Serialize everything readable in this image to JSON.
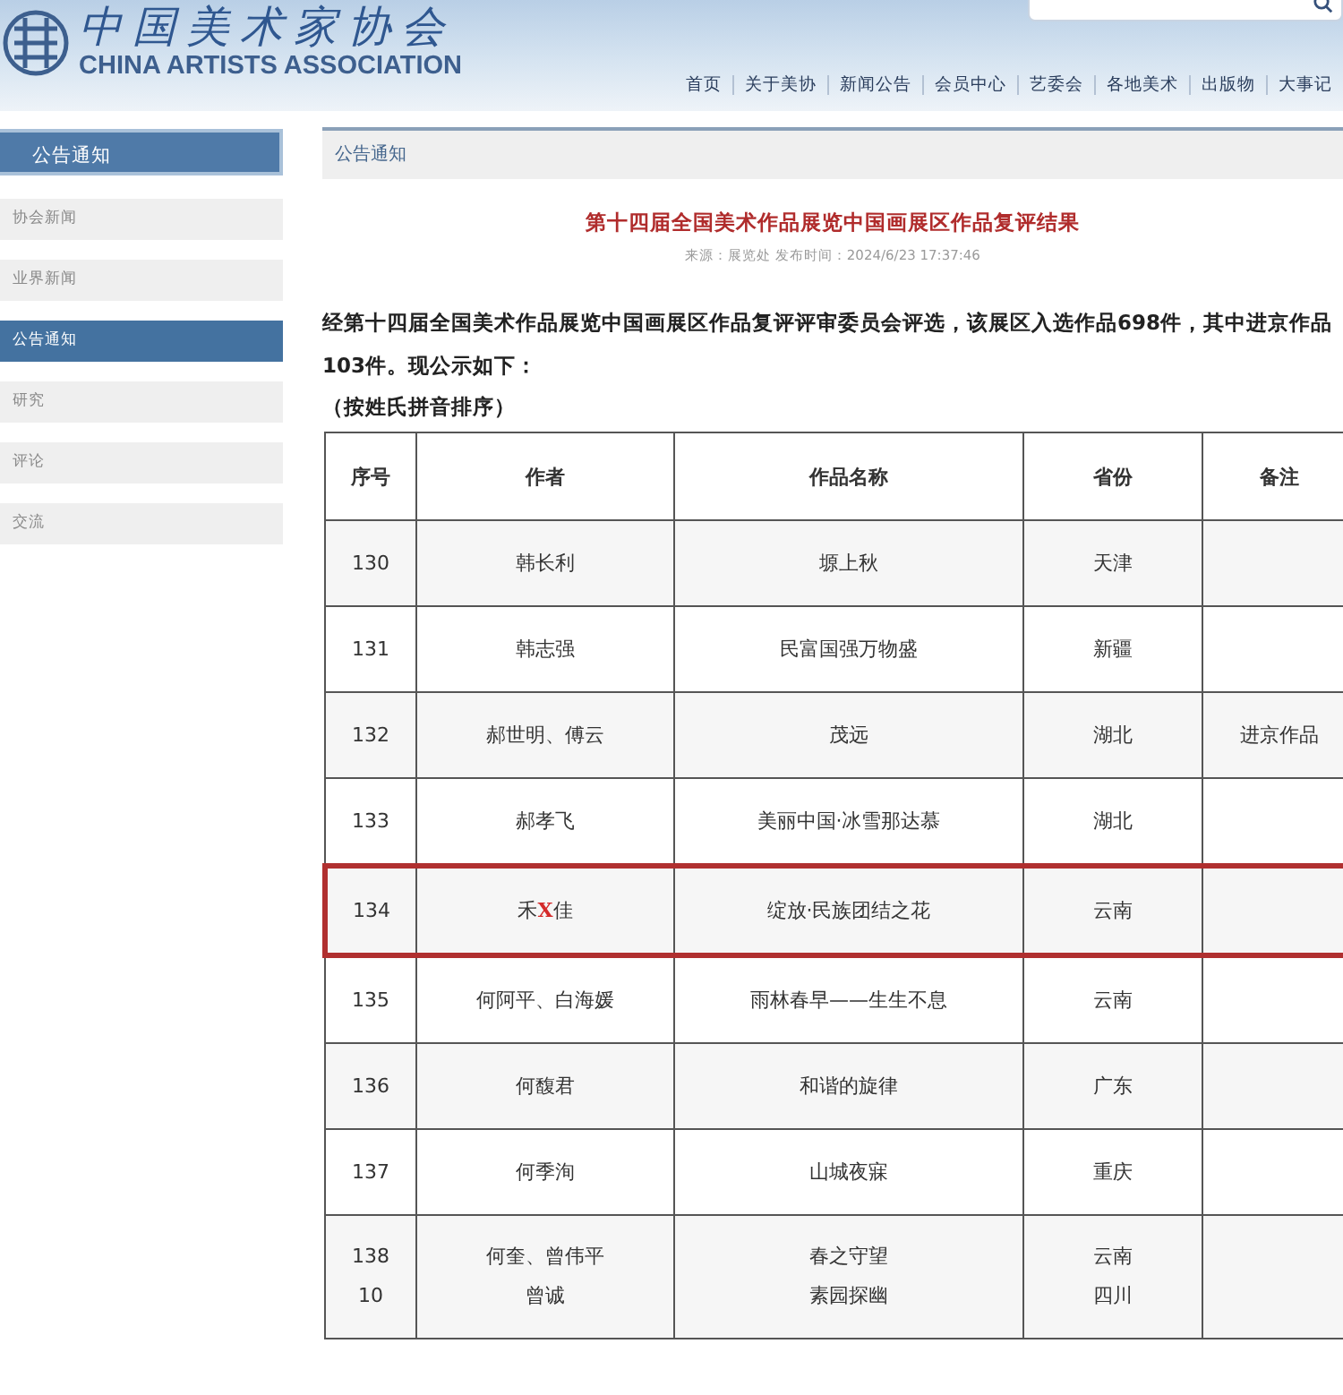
{
  "header": {
    "logo_cn": "中国美术家协会",
    "logo_en": "CHINA ARTISTS ASSOCIATION",
    "nav": [
      "首页",
      "关于美协",
      "新闻公告",
      "会员中心",
      "艺委会",
      "各地美术",
      "出版物",
      "大事记"
    ]
  },
  "sidebar": {
    "title": "公告通知",
    "items": [
      {
        "label": "协会新闻",
        "selected": false
      },
      {
        "label": "业界新闻",
        "selected": false
      },
      {
        "label": "公告通知",
        "selected": true
      },
      {
        "label": "研究",
        "selected": false
      },
      {
        "label": "评论",
        "selected": false
      },
      {
        "label": "交流",
        "selected": false
      }
    ]
  },
  "breadcrumb": "公告通知",
  "article": {
    "title": "第十四届全国美术作品展览中国画展区作品复评结果",
    "meta": "来源：展览处 发布时间：2024/6/23 17:37:46",
    "paragraph": "经第十四届全国美术作品展览中国画展区作品复评评审委员会评选，该展区入选作品698件，其中进京作品103件。现公示如下：",
    "note": "（按姓氏拼音排序）"
  },
  "table": {
    "columns": [
      "序号",
      "作者",
      "作品名称",
      "省份",
      "备注"
    ],
    "rows": [
      {
        "cells": [
          "130",
          "韩长利",
          "塬上秋",
          "天津",
          ""
        ],
        "highlighted": false
      },
      {
        "cells": [
          "131",
          "韩志强",
          "民富国强万物盛",
          "新疆",
          ""
        ],
        "highlighted": false
      },
      {
        "cells": [
          "132",
          "郝世明、傅云",
          "茂远",
          "湖北",
          "进京作品"
        ],
        "highlighted": false
      },
      {
        "cells": [
          "133",
          "郝孝飞",
          "美丽中国·冰雪那达慕",
          "湖北",
          ""
        ],
        "highlighted": false
      },
      {
        "cells": [
          "134",
          "禾**X**佳",
          "绽放·民族团结之花",
          "云南",
          ""
        ],
        "highlighted": true
      },
      {
        "cells": [
          "135",
          "何阿平、白海媛",
          "雨林春早——生生不息",
          "云南",
          ""
        ],
        "highlighted": false
      },
      {
        "cells": [
          "136",
          "何馥君",
          "和谐的旋律",
          "广东",
          ""
        ],
        "highlighted": false
      },
      {
        "cells": [
          "137",
          "何季洵",
          "山城夜寐",
          "重庆",
          ""
        ],
        "highlighted": false
      },
      {
        "cells": [
          [
            "138",
            "10"
          ],
          [
            "何奎、曾伟平",
            "曾诚"
          ],
          [
            "春之守望",
            "素园探幽"
          ],
          [
            "云南",
            "四川"
          ],
          ""
        ],
        "highlighted": false
      }
    ]
  }
}
